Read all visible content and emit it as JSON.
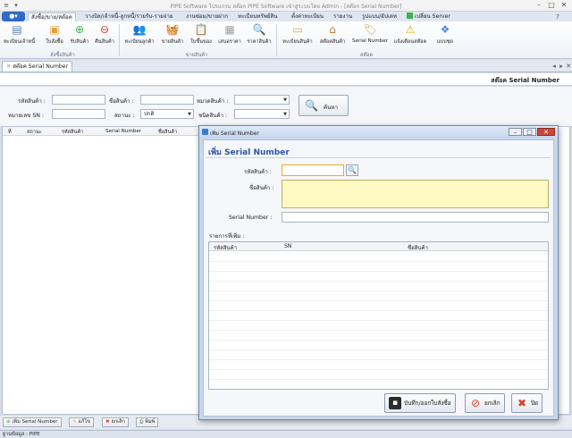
{
  "window": {
    "title": "PIPE Software โปรแกรม สต๊อก PIPE Software เข้าสู่ระบบโดย Admin - [สต๊อก Serial Number]",
    "minimize": "–",
    "maximize": "□",
    "close": "✕"
  },
  "ribbon": {
    "tabs": [
      "สั่งซื้อ/ขาย/สต๊อค",
      "วางบิล/เจ้าหนี้-ลูกหนี้/รายรับ-รายจ่าย",
      "งานซ่อม/ขายฝาก",
      "ทะเบียนทรัพย์สิน",
      "ตั้งค่าทะเบียน",
      "รายงาน",
      "รูปแบบ/อัปเดท",
      "เปลี่ยน Server"
    ],
    "active_tab": "สั่งซื้อ/ขาย/สต๊อค",
    "groups": [
      {
        "label": "สั่งซื้อสินค้า",
        "buttons": [
          {
            "label": "ทะเบียนเจ้าหนี้",
            "icon": "supplier-book-icon"
          },
          {
            "label": "ใบสั่งซื้อ",
            "icon": "purchase-order-icon"
          },
          {
            "label": "รับสินค้า",
            "icon": "receive-goods-icon"
          },
          {
            "label": "คืนสินค้า",
            "icon": "return-goods-icon"
          }
        ]
      },
      {
        "label": "ขายสินค้า",
        "buttons": [
          {
            "label": "ทะเบียนลูกค้า",
            "icon": "customers-icon"
          },
          {
            "label": "ขายสินค้า",
            "icon": "basket-icon"
          },
          {
            "label": "ใบขึ้นของ",
            "icon": "clipboard-icon"
          },
          {
            "label": "เสนอราคา",
            "icon": "quotation-icon"
          },
          {
            "label": "ราคาสินค้า",
            "icon": "magnifier-icon"
          }
        ]
      },
      {
        "label": "สต๊อค",
        "buttons": [
          {
            "label": "ทะเบียนสินค้า",
            "icon": "product-box-icon"
          },
          {
            "label": "สต๊อคสินค้า",
            "icon": "warehouse-icon"
          },
          {
            "label": "Serial Number",
            "icon": "tag-icon"
          },
          {
            "label": "แจ้งเตือนสต๊อค",
            "icon": "warning-icon"
          },
          {
            "label": "แบบชุด",
            "icon": "bundle-icon"
          }
        ]
      }
    ]
  },
  "document_tab": {
    "label": "สต๊อค Serial Number",
    "close": "✕"
  },
  "page_title": "สต๊อค Serial Number",
  "filter": {
    "product_code_label": "รหัสสินค้า :",
    "product_name_label": "ชื่อสินค้า :",
    "category_label": "หมวดสินค้า :",
    "sn_label": "หมายเลข SN :",
    "status_label": "สถานะ :",
    "status_value": "ปกติ",
    "type_label": "ชนิดสินค้า :",
    "search_button": "ค้นหา"
  },
  "grid": {
    "columns": [
      "ที่",
      "สถานะ",
      "รหัสสินค้า",
      "Serial Number",
      "ชื่อสินค้า"
    ]
  },
  "bottom_buttons": {
    "add": "เพิ่ม Serial Number",
    "edit": "แก้ไข",
    "cancel": "ยกเลิก",
    "print": "พิมพ์"
  },
  "status_bar": "ฐานข้อมูล : PIPE",
  "dialog": {
    "title": "เพิ่ม Serial Number",
    "heading": "เพิ่ม Serial Number",
    "product_code_label": "รหัสสินค้า :",
    "product_name_label": "ชื่อสินค้า :",
    "serial_label": "Serial Number :",
    "added_list_label": "รายการที่เพิ่ม :",
    "list_columns": [
      "รหัสสินค้า",
      "SN",
      "ชื่อสินค้า"
    ],
    "save_button": "บันทึก/ออกใบสั่งซื้อ",
    "cancel_button": "ยกเลิก",
    "close_button": "ปิด"
  },
  "colors": {
    "accent": "#2b56a6",
    "highlight": "#fff9c4",
    "focus": "#f5a623"
  }
}
